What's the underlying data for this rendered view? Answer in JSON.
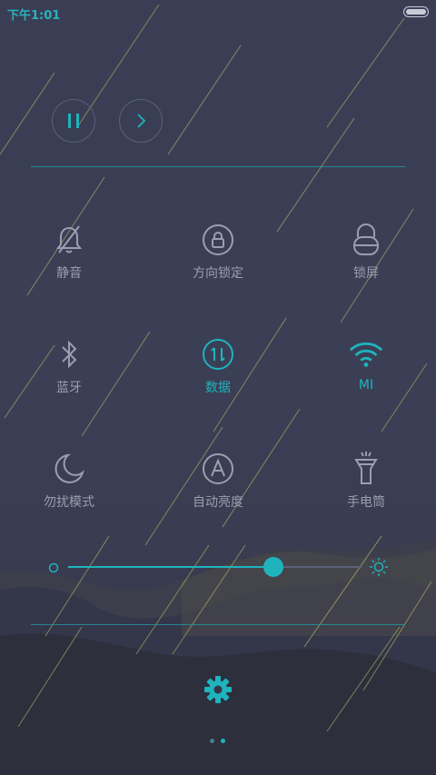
{
  "status_bar": {
    "time": "下午1:01"
  },
  "media_controls": {
    "pause_icon": "pause-icon",
    "next_icon": "chevron-right-icon"
  },
  "toggles": [
    {
      "id": "mute",
      "label": "静音",
      "icon": "bell-slash-icon",
      "active": false
    },
    {
      "id": "orientation-lock",
      "label": "方向锁定",
      "icon": "rotation-lock-icon",
      "active": false
    },
    {
      "id": "lock-screen",
      "label": "锁屏",
      "icon": "lock-icon",
      "active": false
    },
    {
      "id": "bluetooth",
      "label": "蓝牙",
      "icon": "bluetooth-icon",
      "active": false
    },
    {
      "id": "data",
      "label": "数据",
      "icon": "mobile-data-icon",
      "active": true
    },
    {
      "id": "wifi",
      "label": "MI",
      "icon": "wifi-icon",
      "active": true
    },
    {
      "id": "do-not-disturb",
      "label": "勿扰模式",
      "icon": "moon-icon",
      "active": false
    },
    {
      "id": "auto-brightness",
      "label": "自动亮度",
      "icon": "auto-brightness-icon",
      "active": false
    },
    {
      "id": "flashlight",
      "label": "手电筒",
      "icon": "flashlight-icon",
      "active": false
    }
  ],
  "brightness": {
    "level": 0.7
  },
  "settings": {
    "icon": "gear-icon"
  },
  "pager": {
    "count": 2,
    "active_index": 1
  },
  "colors": {
    "accent": "#1fb3bd",
    "inactive": "#9a9fb0",
    "background": "#3a3e55"
  }
}
